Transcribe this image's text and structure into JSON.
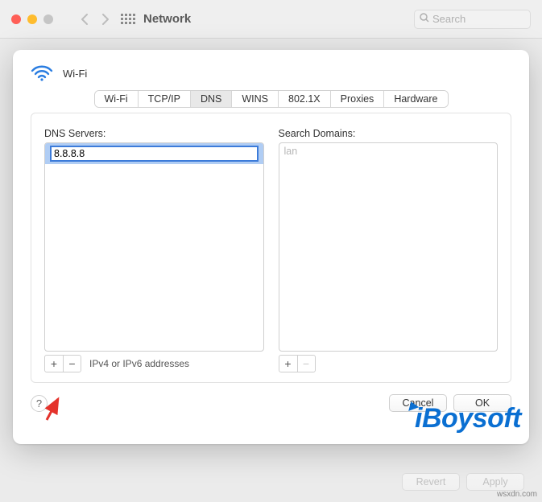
{
  "titlebar": {
    "title": "Network",
    "search_placeholder": "Search"
  },
  "sheet": {
    "connection_name": "Wi-Fi",
    "tabs": [
      "Wi-Fi",
      "TCP/IP",
      "DNS",
      "WINS",
      "802.1X",
      "Proxies",
      "Hardware"
    ],
    "active_tab_index": 2,
    "dns": {
      "label": "DNS Servers:",
      "entries": [
        "8.8.8.8"
      ],
      "editing_index": 0,
      "hint": "IPv4 or IPv6 addresses"
    },
    "domains": {
      "label": "Search Domains:",
      "entries": [],
      "placeholder": "lan"
    },
    "footer": {
      "cancel": "Cancel",
      "ok": "OK"
    }
  },
  "bg_footer": {
    "revert": "Revert",
    "apply": "Apply"
  },
  "watermark": "iBoysoft",
  "domain_mark": "wsxdn.com",
  "icons": {
    "plus": "+",
    "minus": "−",
    "help": "?"
  }
}
